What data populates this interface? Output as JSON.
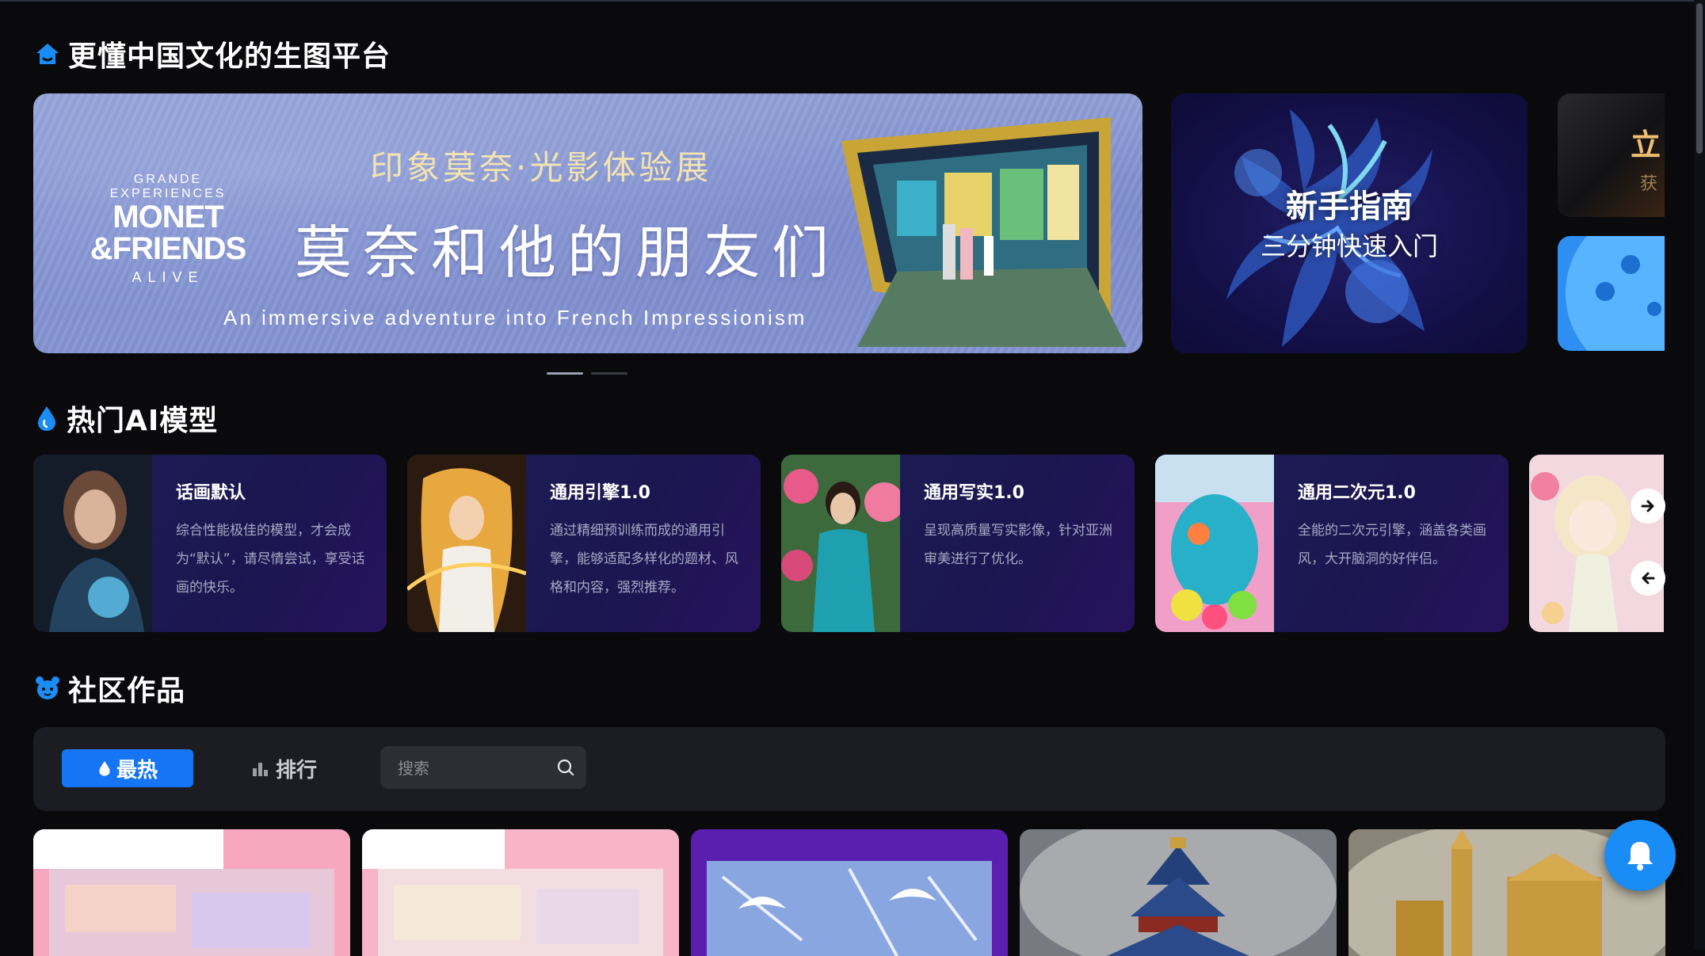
{
  "sections": {
    "platform_title": "更懂中国文化的生图平台",
    "models_title": "热门AI模型",
    "community_title": "社区作品"
  },
  "banner": {
    "logo_small": "GRANDE EXPERIENCES",
    "logo_line1": "MONET",
    "logo_line2": "&FRIENDS",
    "logo_alive": "ALIVE",
    "subtitle": "印象莫奈·光影体验展",
    "title": "莫奈和他的朋友们",
    "tagline": "An immersive adventure into French Impressionism"
  },
  "guide": {
    "title": "新手指南",
    "subtitle": "三分钟快速入门"
  },
  "mini_banner": {
    "text": "立",
    "text2": "获"
  },
  "models": [
    {
      "name": "话画默认",
      "desc": "综合性能极佳的模型，才会成为“默认”，请尽情尝试，享受话画的快乐。"
    },
    {
      "name": "通用引擎1.0",
      "desc": "通过精细预训练而成的通用引擎，能够适配多样化的题材、风格和内容，强烈推荐。"
    },
    {
      "name": "通用写实1.0",
      "desc": "呈现高质量写实影像，针对亚洲审美进行了优化。"
    },
    {
      "name": "通用二次元1.0",
      "desc": "全能的二次元引擎，涵盖各类画风，大开脑洞的好伴侣。"
    }
  ],
  "community": {
    "hot_label": "最热",
    "rank_label": "排行",
    "search_placeholder": "搜索"
  },
  "colors": {
    "accent": "#1675f5",
    "background": "#0a0a0c",
    "card_bg": "#1d1f55"
  },
  "icons": [
    "home-icon",
    "fire-icon",
    "bear-icon",
    "search-icon",
    "bell-icon",
    "arrow-right-icon",
    "arrow-left-icon",
    "bar-chart-icon"
  ]
}
